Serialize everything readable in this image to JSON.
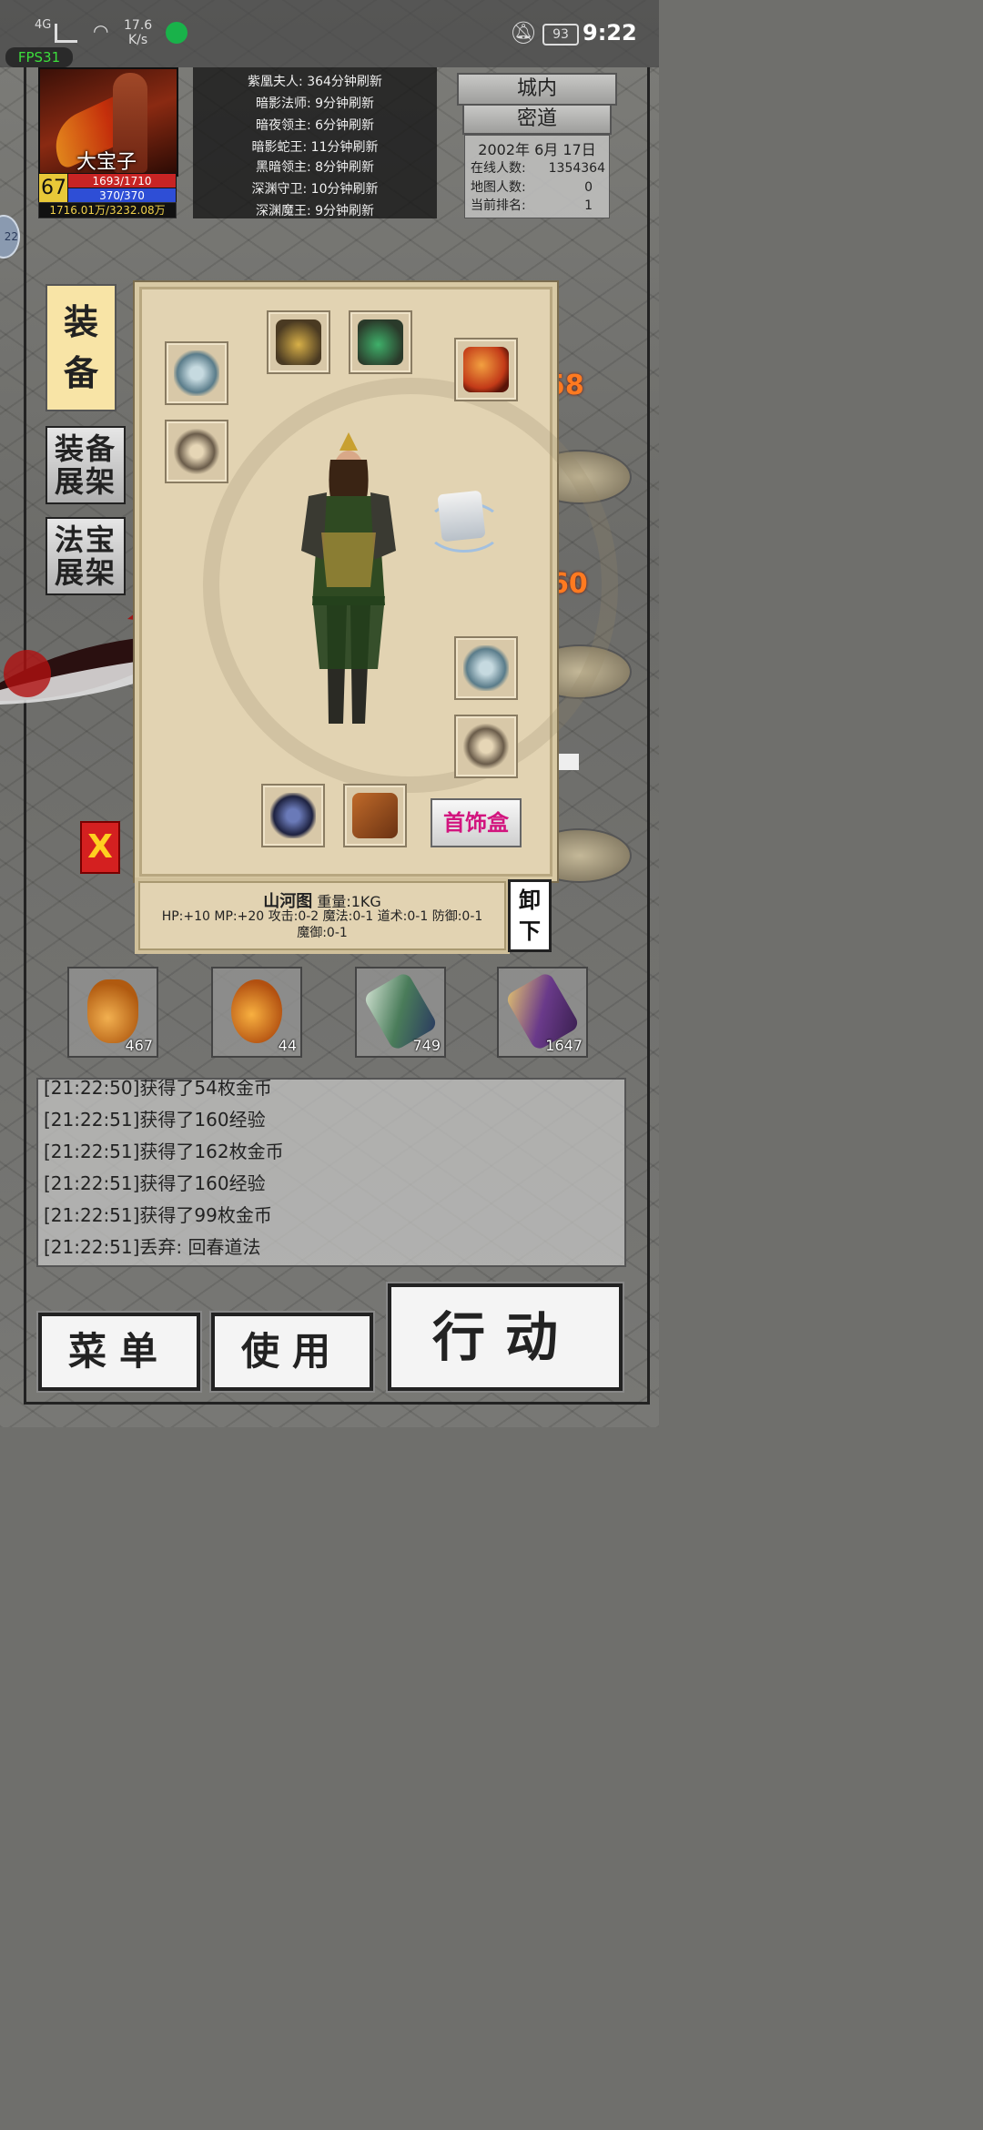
{
  "status_bar": {
    "network": "4G",
    "speed_value": "17.6",
    "speed_unit": "K/s",
    "battery": "93",
    "time": "9:22"
  },
  "fps": "FPS31",
  "player": {
    "name": "大宝子",
    "level": "67",
    "hp": "1693/1710",
    "mp": "370/370",
    "gold": "1716.01万/3232.08万"
  },
  "boss_list": [
    "紫凰夫人: 364分钟刷新",
    "暗影法师: 9分钟刷新",
    "暗夜领主: 6分钟刷新",
    "暗影蛇王: 11分钟刷新",
    "黑暗领主: 8分钟刷新",
    "深渊守卫: 10分钟刷新",
    "深渊魔王: 9分钟刷新"
  ],
  "right_panel": {
    "city_button": "城内",
    "secret_button": "密道",
    "date": "2002年 6月 17日",
    "online_label": "在线人数:",
    "online_value": "1354364",
    "map_label": "地图人数:",
    "map_value": "0",
    "rank_label": "当前排名:",
    "rank_value": "1"
  },
  "tabs": {
    "equip_1": "装",
    "equip_2": "备",
    "equip_rack_1": "装备",
    "equip_rack_2": "展架",
    "treasure_rack_1": "法宝",
    "treasure_rack_2": "展架"
  },
  "close_label": "X",
  "equipment": {
    "jewel_box": "首饰盒",
    "slots": [
      "helmet",
      "necklace",
      "bracelet-left",
      "ring-left",
      "orb",
      "scroll-treasure",
      "bracelet-right",
      "ring-right",
      "belt",
      "boots"
    ]
  },
  "item": {
    "name": "山河图",
    "weight": "重量:1KG",
    "stats": "HP:+10 MP:+20 攻击:0-2 魔法:0-1 道术:0-1 防御:0-1",
    "stats2": "魔御:0-1"
  },
  "unequip": {
    "line1": "卸",
    "line2": "下"
  },
  "potions": [
    {
      "name": "small-hp-potion",
      "count": "467"
    },
    {
      "name": "large-hp-potion",
      "count": "44"
    },
    {
      "name": "teleport-scroll",
      "count": "749"
    },
    {
      "name": "return-scroll",
      "count": "1647"
    }
  ],
  "log": [
    "[21:22:50]获得了54枚金币",
    "[21:22:51]获得了160经验",
    "[21:22:51]获得了162枚金币",
    "[21:22:51]获得了160经验",
    "[21:22:51]获得了99枚金币",
    "[21:22:51]丢弃: 回春道法"
  ],
  "buttons": {
    "menu": "菜单",
    "use": "使用",
    "action": "行动"
  },
  "damage_numbers": [
    "58",
    "60"
  ],
  "colors": {
    "hp_bar": "#c82424",
    "mp_bar": "#2e4ed6",
    "gold_text": "#f2d24a",
    "jewel_box_text": "#d2147e",
    "damage": "#ff7a20"
  }
}
